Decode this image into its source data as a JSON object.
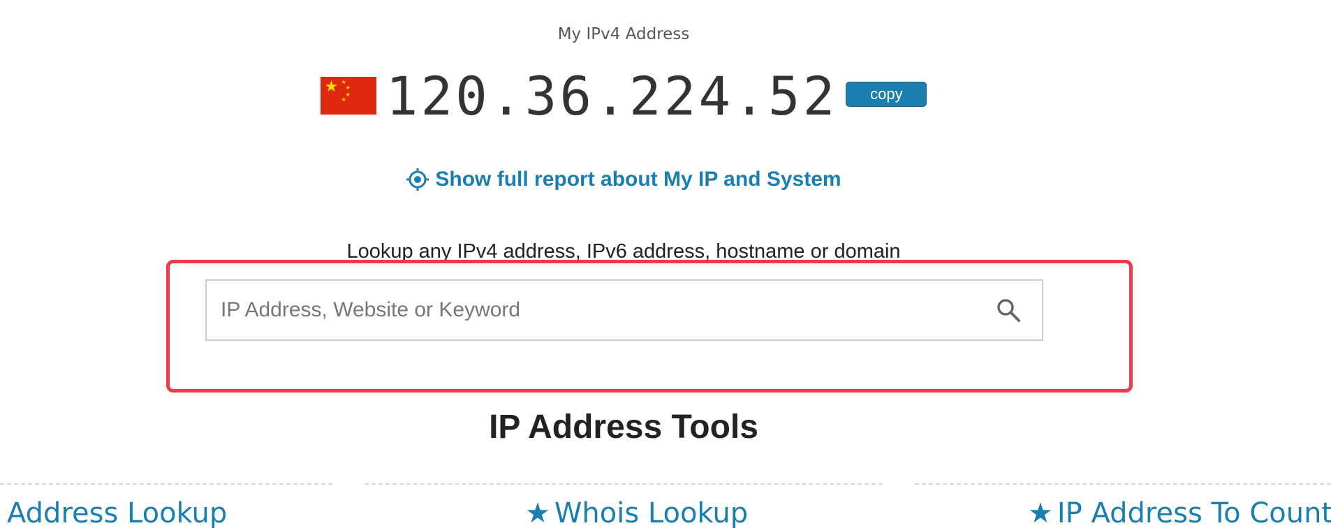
{
  "header": {
    "label": "My IPv4 Address",
    "ip": "120.36.224.52",
    "copy_label": "copy",
    "flag": "china-flag"
  },
  "report_link": {
    "text": "Show full report about My IP and System",
    "icon": "target-icon"
  },
  "lookup": {
    "description": "Lookup any IPv4 address, IPv6 address, hostname or domain",
    "placeholder": "IP Address, Website or Keyword",
    "search_icon": "search-icon"
  },
  "tools": {
    "title": "IP Address Tools",
    "links": [
      {
        "label": "Address Lookup",
        "starred": false
      },
      {
        "label": "Whois Lookup",
        "starred": true
      },
      {
        "label": "IP Address To Country",
        "starred": true
      }
    ]
  },
  "colors": {
    "link_blue": "#1a7fb0",
    "highlight_red": "#ef3a4c"
  }
}
